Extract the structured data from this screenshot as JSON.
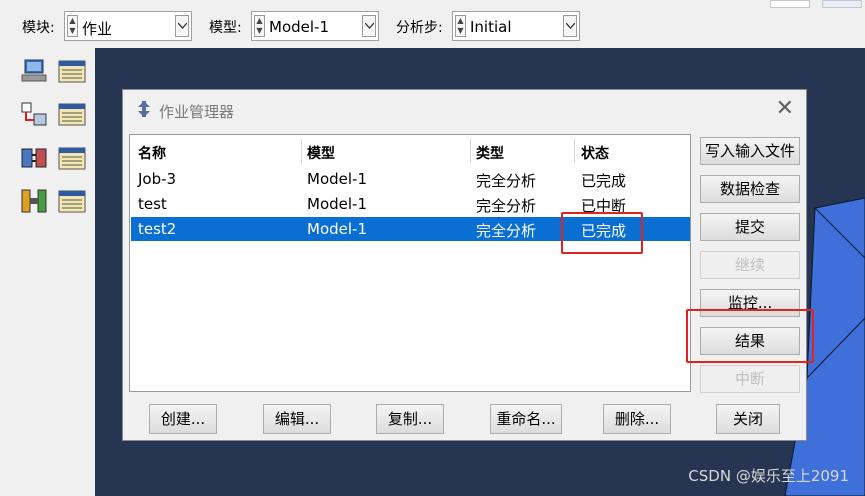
{
  "toolbar": {
    "module_label": "模块:",
    "module_value": "作业",
    "model_label": "模型:",
    "model_value": "Model-1",
    "step_label": "分析步:",
    "step_value": "Initial"
  },
  "dialog": {
    "title": "作业管理器",
    "close_icon": "close-icon",
    "columns": [
      "名称",
      "模型",
      "类型",
      "状态"
    ],
    "rows": [
      {
        "name": "Job-3",
        "model": "Model-1",
        "type": "完全分析",
        "status": "已完成",
        "selected": false
      },
      {
        "name": "test",
        "model": "Model-1",
        "type": "完全分析",
        "status": "已中断",
        "selected": false
      },
      {
        "name": "test2",
        "model": "Model-1",
        "type": "完全分析",
        "status": "已完成",
        "selected": true
      }
    ],
    "side_buttons": [
      {
        "label": "写入输入文件",
        "enabled": true
      },
      {
        "label": "数据检查",
        "enabled": true
      },
      {
        "label": "提交",
        "enabled": true
      },
      {
        "label": "继续",
        "enabled": false
      },
      {
        "label": "监控...",
        "enabled": true
      },
      {
        "label": "结果",
        "enabled": true
      },
      {
        "label": "中断",
        "enabled": false
      }
    ],
    "bottom_buttons": [
      "创建...",
      "编辑...",
      "复制...",
      "重命名...",
      "删除...",
      "关闭"
    ]
  },
  "colors": {
    "selection": "#0a6fd3",
    "highlight": "#e52222",
    "viewport": "#263551"
  },
  "watermark": "CSDN @娱乐至上2091"
}
